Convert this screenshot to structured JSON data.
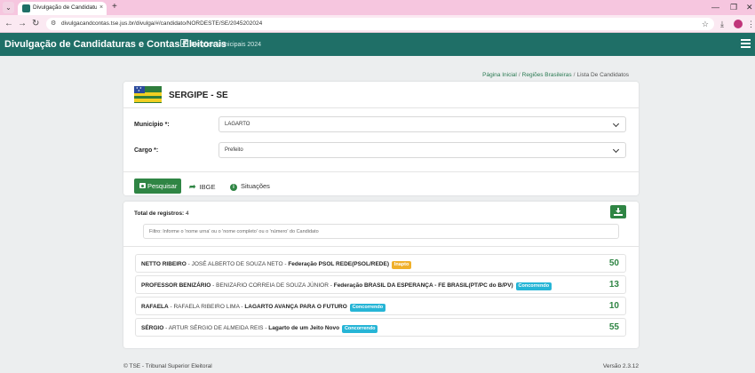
{
  "browser": {
    "tab_title": "Divulgação de Candidaturas e C",
    "tab_close": "×",
    "new_tab": "+",
    "url": "divulgacandcontas.tse.jus.br/divulga/#/candidato/NORDESTE/SE/2045202024",
    "minimize": "—",
    "restore": "❐",
    "close": "✕"
  },
  "header": {
    "title": "Divulgação de Candidaturas e Contas Eleitorais",
    "election": "Eleições Municipais 2024"
  },
  "breadcrumb": {
    "items": [
      "Página Inicial",
      "Regiões Brasileiras",
      "Lista De Candidatos"
    ],
    "separator": "/"
  },
  "search": {
    "state_title": "SERGIPE - SE",
    "municipio_label": "Município *:",
    "municipio_value": "LAGARTO",
    "cargo_label": "Cargo *:",
    "cargo_value": "Prefeito",
    "search_button": "Pesquisar",
    "ibge_link": "IBGE",
    "situacoes_link": "Situações"
  },
  "results": {
    "total_label": "Total de registros:",
    "total_value": "4",
    "filter_placeholder": "Filtro: Informe o 'nome urna' ou o 'nome completo' ou o 'número' do Candidato",
    "candidates": [
      {
        "nome_urna": "NETTO RIBEIRO",
        "nome_completo": "JOSÉ ALBERTO DE SOUZA NETO",
        "partido": "Federação PSOL REDE(PSOL/REDE)",
        "situacao": "Inapto",
        "numero": "50"
      },
      {
        "nome_urna": "PROFESSOR BENIZÁRIO",
        "nome_completo": "BENIZARIO CORREIA DE SOUZA JÚNIOR",
        "partido": "Federação BRASIL DA ESPERANÇA - FE BRASIL(PT/PC do B/PV)",
        "situacao": "Concorrendo",
        "numero": "13"
      },
      {
        "nome_urna": "RAFAELA",
        "nome_completo": "RAFAELA RIBEIRO LIMA",
        "partido": "LAGARTO AVANÇA PARA O FUTURO",
        "situacao": "Concorrendo",
        "numero": "10"
      },
      {
        "nome_urna": "SÉRGIO",
        "nome_completo": "ARTUR SÉRGIO DE ALMEIDA REIS",
        "partido": "Lagarto de um Jeito Novo",
        "situacao": "Concorrendo",
        "numero": "55"
      }
    ]
  },
  "footer": {
    "copyright": "© TSE - Tribunal Superior Eleitoral",
    "version": "Versão 2.3.12"
  },
  "colors": {
    "header_bg": "#1f6f67",
    "primary_green": "#2f8544",
    "badge_inapto": "#f0b02a",
    "badge_concorrendo": "#26b5d6"
  }
}
